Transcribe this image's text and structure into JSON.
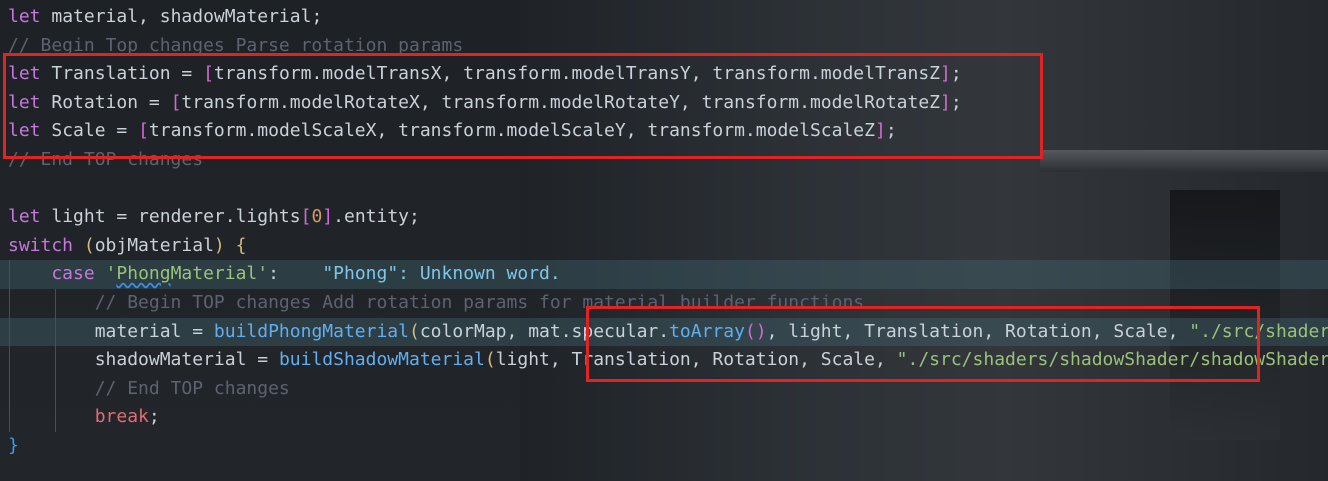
{
  "editor": {
    "lines": [
      {
        "segments": [
          {
            "t": "let ",
            "c": "kw"
          },
          {
            "t": "material, shadowMaterial;",
            "c": "id"
          }
        ]
      },
      {
        "segments": [
          {
            "t": "// Begin Top changes Parse rotation params",
            "c": "cmt"
          }
        ]
      },
      {
        "segments": [
          {
            "t": "let ",
            "c": "kw"
          },
          {
            "t": "Translation = ",
            "c": "id"
          },
          {
            "t": "[",
            "c": "br2"
          },
          {
            "t": "transform.modelTransX, transform.modelTransY, transform.modelTransZ",
            "c": "id"
          },
          {
            "t": "]",
            "c": "br2"
          },
          {
            "t": ";",
            "c": "id"
          }
        ]
      },
      {
        "segments": [
          {
            "t": "let ",
            "c": "kw"
          },
          {
            "t": "Rotation = ",
            "c": "id"
          },
          {
            "t": "[",
            "c": "br2"
          },
          {
            "t": "transform.modelRotateX, transform.modelRotateY, transform.modelRotateZ",
            "c": "id"
          },
          {
            "t": "]",
            "c": "br2"
          },
          {
            "t": ";",
            "c": "id"
          }
        ]
      },
      {
        "segments": [
          {
            "t": "let ",
            "c": "kw"
          },
          {
            "t": "Scale = ",
            "c": "id"
          },
          {
            "t": "[",
            "c": "br2"
          },
          {
            "t": "transform.modelScaleX, transform.modelScaleY, transform.modelScaleZ",
            "c": "id"
          },
          {
            "t": "]",
            "c": "br2"
          },
          {
            "t": ";",
            "c": "id"
          }
        ]
      },
      {
        "segments": [
          {
            "t": "// End TOP changes",
            "c": "cmt"
          }
        ]
      },
      {
        "segments": []
      },
      {
        "segments": [
          {
            "t": "let ",
            "c": "kw"
          },
          {
            "t": "light = renderer.lights",
            "c": "id"
          },
          {
            "t": "[",
            "c": "br2"
          },
          {
            "t": "0",
            "c": "num"
          },
          {
            "t": "]",
            "c": "br2"
          },
          {
            "t": ".entity;",
            "c": "id"
          }
        ]
      },
      {
        "segments": [
          {
            "t": "switch ",
            "c": "kw"
          },
          {
            "t": "(",
            "c": "brk"
          },
          {
            "t": "objMaterial",
            "c": "id"
          },
          {
            "t": ")",
            "c": "brk"
          },
          {
            "t": " {",
            "c": "brk"
          }
        ]
      },
      {
        "hl": true,
        "guides": 1,
        "segments": [
          {
            "t": "    case ",
            "c": "kw"
          },
          {
            "t": "'",
            "c": "str"
          },
          {
            "t": "Phong",
            "c": "str squig"
          },
          {
            "t": "Material'",
            "c": "str"
          },
          {
            "t": ":",
            "c": "id"
          },
          {
            "t": "    \"Phong\": Unknown word.",
            "c": "hint"
          }
        ]
      },
      {
        "guides": 2,
        "segments": [
          {
            "t": "        // Begin TOP changes Add rotation params for material builder functions",
            "c": "cmt"
          }
        ]
      },
      {
        "hl": true,
        "guides": 2,
        "segments": [
          {
            "t": "        material = ",
            "c": "id"
          },
          {
            "t": "buildPhongMaterial",
            "c": "fn"
          },
          {
            "t": "(",
            "c": "brk"
          },
          {
            "t": "colorMap, mat.specular.",
            "c": "id"
          },
          {
            "t": "toArray",
            "c": "fn"
          },
          {
            "t": "()",
            "c": "br2"
          },
          {
            "t": ", light, Translation, Rotation, Scale, ",
            "c": "id"
          },
          {
            "t": "\"./src/shaders/phongShader\"",
            "c": "str"
          }
        ]
      },
      {
        "guides": 2,
        "segments": [
          {
            "t": "        shadowMaterial = ",
            "c": "id"
          },
          {
            "t": "buildShadowMaterial",
            "c": "fn"
          },
          {
            "t": "(",
            "c": "brk"
          },
          {
            "t": "light, Translation, Rotation, Scale, ",
            "c": "id"
          },
          {
            "t": "\"./src/shaders/shadowShader/shadowShader\"",
            "c": "str"
          }
        ]
      },
      {
        "guides": 2,
        "segments": [
          {
            "t": "        // End TOP changes",
            "c": "cmt"
          }
        ]
      },
      {
        "guides": 2,
        "segments": [
          {
            "t": "        break",
            "c": "kw2"
          },
          {
            "t": ";",
            "c": "id"
          }
        ]
      },
      {
        "segments": [
          {
            "t": "}",
            "c": "br3"
          }
        ]
      }
    ]
  },
  "colors": {
    "highlight_box": "#e02424",
    "background": "#1f2328"
  }
}
